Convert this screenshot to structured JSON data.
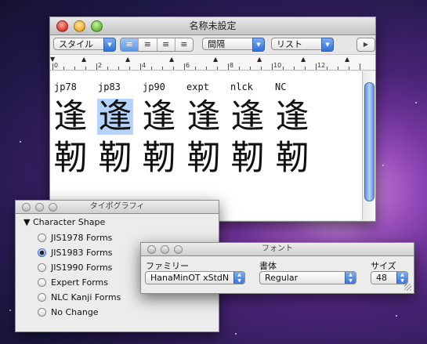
{
  "main_window": {
    "title": "名称未設定",
    "toolbar": {
      "style_popup": "スタイル",
      "align_segments": [
        "≡",
        "≡",
        "≡",
        "≡"
      ],
      "spacing_popup": "間隔",
      "list_popup": "リスト"
    },
    "ruler_numbers": [
      "0",
      "2",
      "4",
      "6",
      "8",
      "10",
      "12"
    ],
    "columns": [
      "jp78",
      "jp83",
      "jp90",
      "expt",
      "nlck",
      "NC"
    ],
    "row1_kanji": [
      "逢",
      "逢",
      "逢",
      "逢",
      "逢",
      "逢"
    ],
    "row2_kanji": [
      "靭",
      "靭",
      "靭",
      "靭",
      "靭",
      "靭"
    ],
    "selected_column": 1
  },
  "typography_panel": {
    "title": "タイポグラフィ",
    "section": "Character Shape",
    "options": [
      {
        "label": "JIS1978 Forms",
        "selected": false
      },
      {
        "label": "JIS1983 Forms",
        "selected": true
      },
      {
        "label": "JIS1990 Forms",
        "selected": false
      },
      {
        "label": "Expert Forms",
        "selected": false
      },
      {
        "label": "NLC Kanji Forms",
        "selected": false
      },
      {
        "label": "No Change",
        "selected": false
      }
    ]
  },
  "font_panel": {
    "title": "フォント",
    "family_label": "ファミリー",
    "family_value": "HanaMinOT xStdN",
    "typeface_label": "書体",
    "typeface_value": "Regular",
    "size_label": "サイズ",
    "size_value": "48"
  },
  "colors": {
    "selection": "#b5d3fb",
    "accent": "#3b7ad9"
  }
}
